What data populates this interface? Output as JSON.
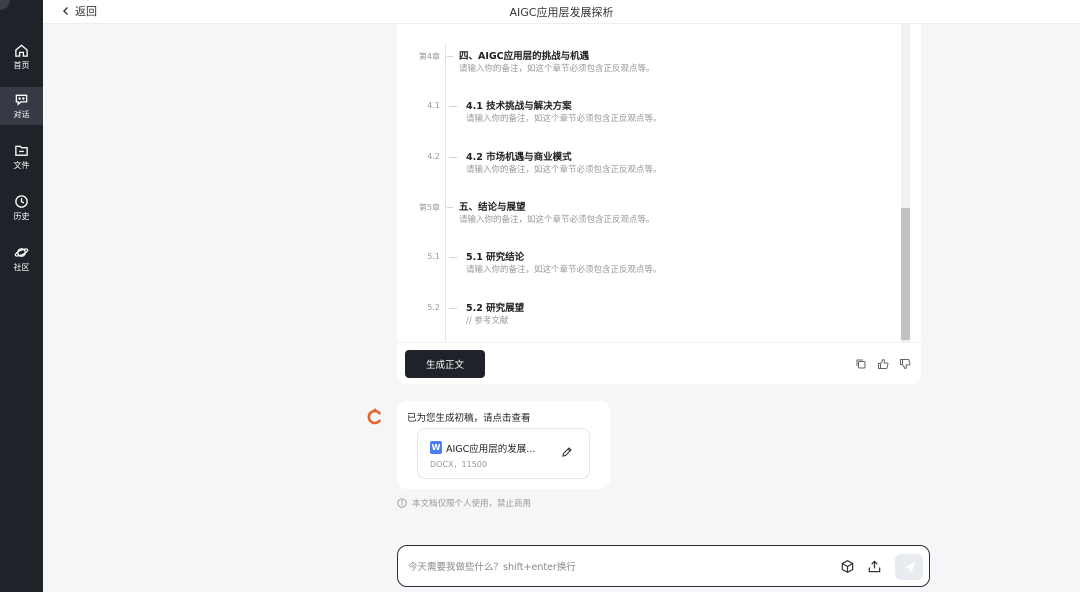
{
  "sidebar": {
    "items": [
      {
        "label": "首页",
        "icon": "home-icon"
      },
      {
        "label": "对话",
        "icon": "chat-icon"
      },
      {
        "label": "文件",
        "icon": "folder-icon"
      },
      {
        "label": "历史",
        "icon": "history-icon"
      },
      {
        "label": "社区",
        "icon": "planet-icon"
      }
    ]
  },
  "header": {
    "back_label": "返回",
    "title": "AIGC应用层发展探析"
  },
  "outline": {
    "sections": [
      {
        "num": "第4章",
        "title": "四、AIGC应用层的挑战与机遇",
        "note": "请输入你的备注，如这个章节必须包含正反观点等。"
      },
      {
        "num": "4.1",
        "title": "4.1 技术挑战与解决方案",
        "note": "请输入你的备注，如这个章节必须包含正反观点等。"
      },
      {
        "num": "4.2",
        "title": "4.2 市场机遇与商业模式",
        "note": "请输入你的备注，如这个章节必须包含正反观点等。"
      },
      {
        "num": "第5章",
        "title": "五、结论与展望",
        "note": "请输入你的备注，如这个章节必须包含正反观点等。"
      },
      {
        "num": "5.1",
        "title": "5.1 研究结论",
        "note": "请输入你的备注，如这个章节必须包含正反观点等。"
      },
      {
        "num": "5.2",
        "title": "5.2 研究展望",
        "note": "// 参考文献"
      }
    ],
    "generate_label": "生成正文"
  },
  "message": {
    "text": "已为您生成初稿，请点击查看",
    "file": {
      "name": "AIGC应用层的发展...",
      "meta": "DOCX，11500"
    },
    "disclaimer": "本文档仅限个人使用，禁止商用"
  },
  "input": {
    "placeholder": "今天需要我做些什么？shift+enter换行"
  },
  "colors": {
    "sidebar_bg": "#1f2229",
    "accent_orange": "#e8642c",
    "doc_blue": "#4e7cf6"
  }
}
